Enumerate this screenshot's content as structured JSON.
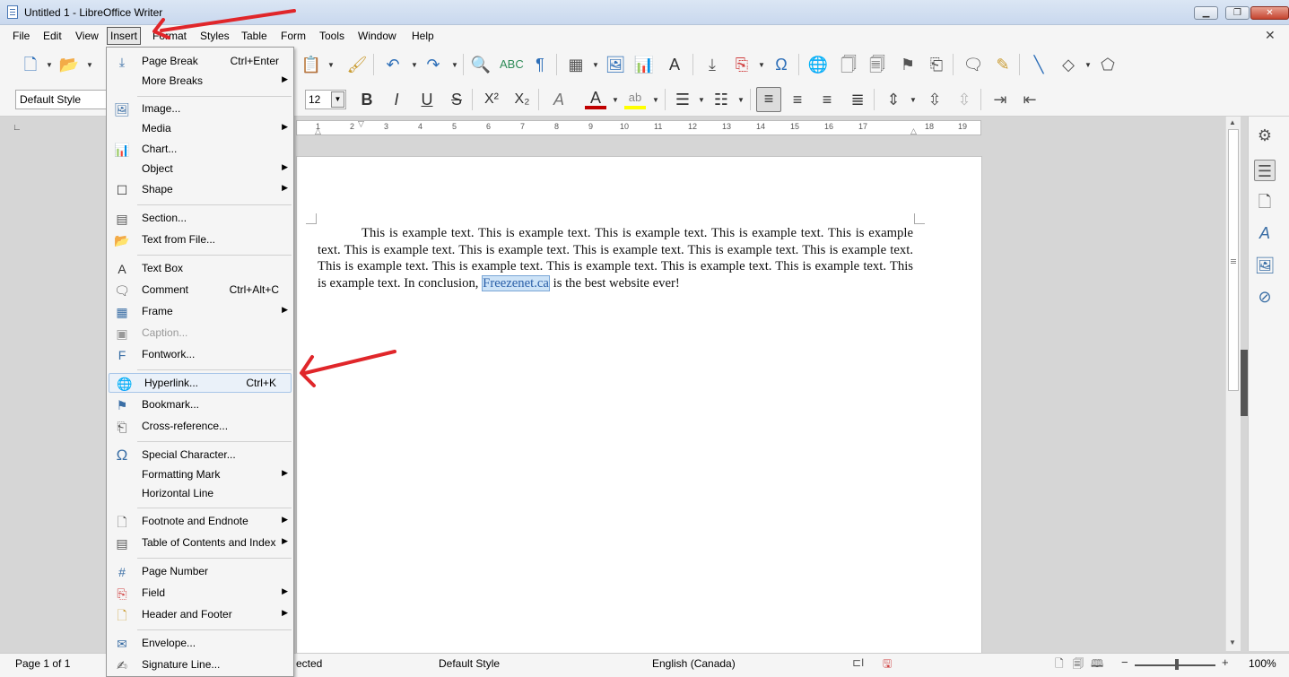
{
  "window": {
    "title": "Untitled 1 - LibreOffice Writer"
  },
  "menubar": [
    "File",
    "Edit",
    "View",
    "Insert",
    "Format",
    "Styles",
    "Table",
    "Form",
    "Tools",
    "Window",
    "Help"
  ],
  "toolbar2": {
    "paragraph_style": "Default Style",
    "font_size": "12"
  },
  "ruler": [
    "1",
    "2",
    "3",
    "4",
    "5",
    "6",
    "7",
    "8",
    "9",
    "10",
    "11",
    "12",
    "13",
    "14",
    "15",
    "16",
    "17",
    "18",
    "19"
  ],
  "document": {
    "text_before": "This is example text.  This is example text.  This is example text.  This is example text.  This is example text.  This is example text.  This is example text.  This is example text.  This is example text.  This is example text.  This is example text.  This is example text.  This is example text.  This is example text.  This is example text.  This is example text.  In conclusion, ",
    "link_text": "Freezenet.ca",
    "text_after": " is the best website ever!"
  },
  "insert_menu": {
    "items": [
      {
        "label": "Page Break",
        "shortcut": "Ctrl+Enter",
        "icon": "page-break-icon"
      },
      {
        "label": "More Breaks",
        "icon": ""
      },
      {
        "label": "Image...",
        "icon": "image-icon"
      },
      {
        "label": "Media",
        "icon": ""
      },
      {
        "label": "Chart...",
        "icon": "chart-icon"
      },
      {
        "label": "Object",
        "icon": ""
      },
      {
        "label": "Shape",
        "icon": "shape-icon"
      },
      {
        "label": "Section...",
        "icon": "section-icon"
      },
      {
        "label": "Text from File...",
        "icon": "folder-icon"
      },
      {
        "label": "Text Box",
        "icon": "text-box-icon"
      },
      {
        "label": "Comment",
        "shortcut": "Ctrl+Alt+C",
        "icon": "comment-icon"
      },
      {
        "label": "Frame",
        "icon": "frame-icon"
      },
      {
        "label": "Caption...",
        "icon": "caption-icon"
      },
      {
        "label": "Fontwork...",
        "icon": "fontwork-icon"
      },
      {
        "label": "Hyperlink...",
        "shortcut": "Ctrl+K",
        "icon": "hyperlink-icon"
      },
      {
        "label": "Bookmark...",
        "icon": "bookmark-icon"
      },
      {
        "label": "Cross-reference...",
        "icon": "cross-reference-icon"
      },
      {
        "label": "Special Character...",
        "icon": "omega-icon"
      },
      {
        "label": "Formatting Mark",
        "icon": ""
      },
      {
        "label": "Horizontal Line",
        "icon": ""
      },
      {
        "label": "Footnote and Endnote",
        "icon": "footnote-icon"
      },
      {
        "label": "Table of Contents and Index",
        "icon": "toc-icon"
      },
      {
        "label": "Page Number",
        "icon": "page-number-icon"
      },
      {
        "label": "Field",
        "icon": "field-icon"
      },
      {
        "label": "Header and Footer",
        "icon": "header-footer-icon"
      },
      {
        "label": "Envelope...",
        "icon": "envelope-icon"
      },
      {
        "label": "Signature Line...",
        "icon": "signature-icon"
      }
    ]
  },
  "statusbar": {
    "page": "Page 1 of 1",
    "selection": "ected",
    "page_style": "Default Style",
    "language": "English (Canada)",
    "zoom": "100%"
  },
  "colors": {
    "annotation_arrow": "#e0262a",
    "font_color_bar": "#c00000",
    "highlight_bar": "#ffff00",
    "link_highlight": "#cde3f7"
  }
}
